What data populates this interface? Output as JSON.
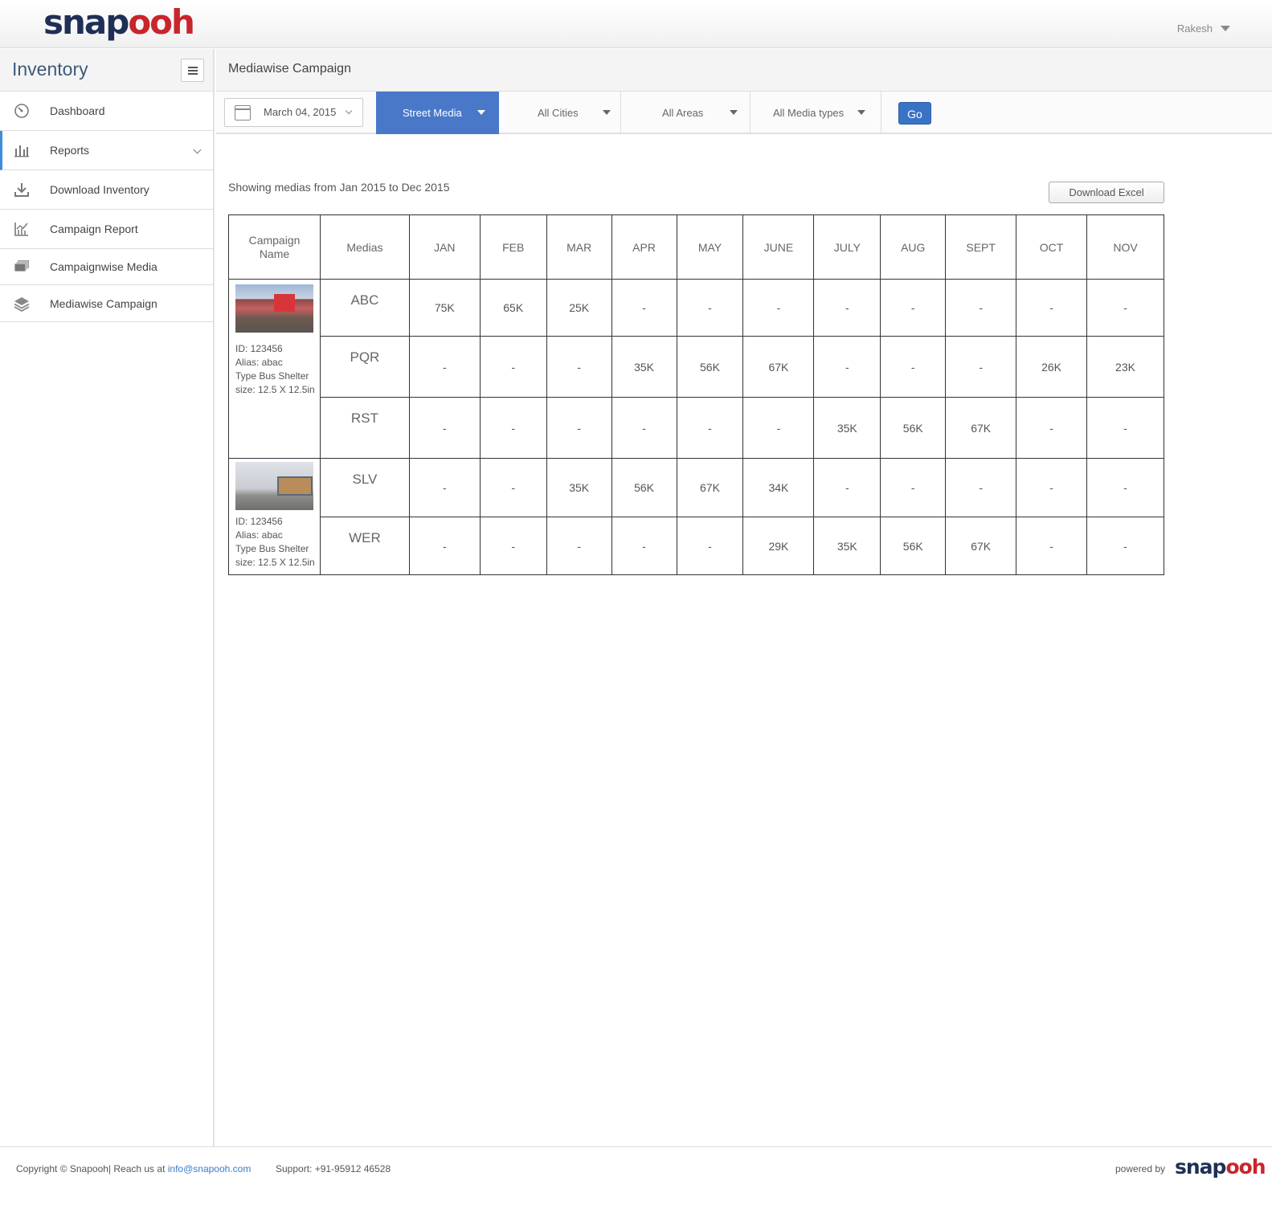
{
  "header": {
    "logo_part1": "snap",
    "logo_part2": "ooh",
    "user_name": "Rakesh"
  },
  "sidebar": {
    "title": "Inventory",
    "items": [
      {
        "label": "Dashboard",
        "icon": "dashboard-icon"
      },
      {
        "label": "Reports",
        "icon": "bar-chart-icon"
      },
      {
        "label": "Download Inventory",
        "icon": "download-icon"
      },
      {
        "label": "Campaign Report",
        "icon": "line-chart-icon"
      },
      {
        "label": "Campaignwise Media",
        "icon": "stack-icon"
      },
      {
        "label": "Mediawise Campaign",
        "icon": "layers-icon"
      }
    ]
  },
  "page": {
    "title": "Mediawise Campaign"
  },
  "filters": {
    "date": "March 04, 2015",
    "media_category": "Street Media",
    "city": "All Cities",
    "area": "All Areas",
    "media_type": "All Media types",
    "go_label": "Go"
  },
  "content": {
    "showing_text": "Showing medias from Jan 2015 to Dec 2015",
    "download_label": "Download Excel"
  },
  "table": {
    "headers": [
      "Campaign Name",
      "Medias",
      "JAN",
      "FEB",
      "MAR",
      "APR",
      "MAY",
      "JUNE",
      "JULY",
      "AUG",
      "SEPT",
      "OCT",
      "NOV"
    ],
    "campaigns": [
      {
        "id": "ID: 123456",
        "alias": "Alias: abac",
        "type": "Type Bus Shelter",
        "size": "size: 12.5 X 12.5in",
        "rows": [
          {
            "media": "ABC",
            "values": [
              "75K",
              "65K",
              "25K",
              "-",
              "-",
              "-",
              "-",
              "-",
              "-",
              "-",
              "-"
            ]
          },
          {
            "media": "PQR",
            "values": [
              "-",
              "-",
              "-",
              "35K",
              "56K",
              "67K",
              "-",
              "-",
              "-",
              "26K",
              "23K"
            ]
          },
          {
            "media": "RST",
            "values": [
              "-",
              "-",
              "-",
              "-",
              "-",
              "-",
              "35K",
              "56K",
              "67K",
              "-",
              "-"
            ]
          }
        ]
      },
      {
        "id": "ID: 123456",
        "alias": "Alias: abac",
        "type": "Type Bus Shelter",
        "size": "size: 12.5 X 12.5in",
        "rows": [
          {
            "media": "SLV",
            "values": [
              "-",
              "-",
              "35K",
              "56K",
              "67K",
              "34K",
              "-",
              "-",
              "-",
              "-",
              "-"
            ]
          },
          {
            "media": "WER",
            "values": [
              "-",
              "-",
              "-",
              "-",
              "-",
              "29K",
              "35K",
              "56K",
              "67K",
              "-",
              "-"
            ]
          }
        ]
      }
    ]
  },
  "footer": {
    "copyright": "Copyright © Snapooh| Reach us at ",
    "email": "info@snapooh.com",
    "support": "Support: +91-95912 46528",
    "powered_by": "powered by",
    "logo_part1": "snap",
    "logo_part2": "ooh"
  },
  "colors": {
    "brand_navy": "#1f2f56",
    "brand_red": "#c9252c",
    "accent_blue": "#4a78c9",
    "link_blue": "#3b7ccc"
  }
}
